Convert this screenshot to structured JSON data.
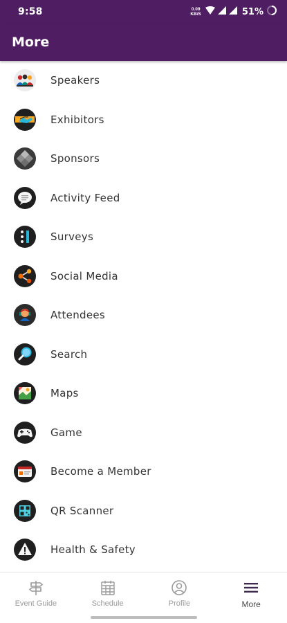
{
  "status_bar": {
    "time": "9:58",
    "net_speed_top": "0.09",
    "net_speed_bottom": "KB/S",
    "battery_percent": "51%"
  },
  "app_bar": {
    "title": "More"
  },
  "menu": {
    "items": [
      {
        "label": "Speakers",
        "icon": "speakers-icon"
      },
      {
        "label": "Exhibitors",
        "icon": "exhibitors-icon"
      },
      {
        "label": "Sponsors",
        "icon": "sponsors-icon"
      },
      {
        "label": "Activity Feed",
        "icon": "activity-feed-icon"
      },
      {
        "label": "Surveys",
        "icon": "surveys-icon"
      },
      {
        "label": "Social Media",
        "icon": "social-media-icon"
      },
      {
        "label": "Attendees",
        "icon": "attendees-icon"
      },
      {
        "label": "Search",
        "icon": "search-icon"
      },
      {
        "label": "Maps",
        "icon": "maps-icon"
      },
      {
        "label": "Game",
        "icon": "game-icon"
      },
      {
        "label": "Become a Member",
        "icon": "become-member-icon"
      },
      {
        "label": "QR Scanner",
        "icon": "qr-scanner-icon"
      },
      {
        "label": "Health & Safety",
        "icon": "health-safety-icon"
      }
    ]
  },
  "bottom_nav": {
    "items": [
      {
        "label": "Event Guide",
        "icon": "signpost-icon"
      },
      {
        "label": "Schedule",
        "icon": "calendar-icon"
      },
      {
        "label": "Profile",
        "icon": "profile-icon"
      },
      {
        "label": "More",
        "icon": "hamburger-menu-icon",
        "active": true
      }
    ]
  },
  "colors": {
    "brand_purple": "#4f1d61",
    "icon_dark": "#1f1f1f"
  }
}
